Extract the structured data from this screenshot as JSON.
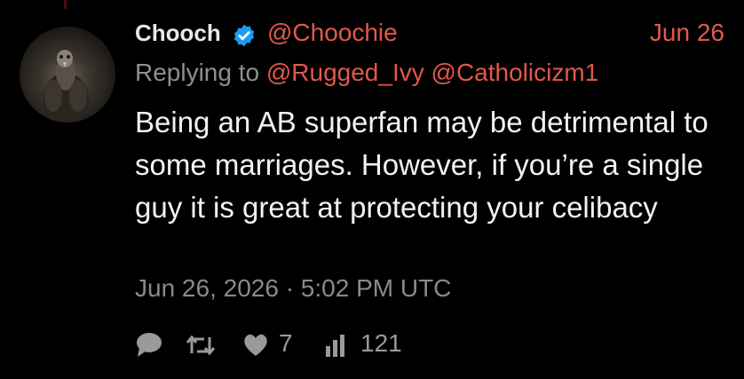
{
  "tweet": {
    "author_name": "Chooch",
    "author_handle": "@Choochie",
    "date_short": "Jun 26",
    "replying_prefix": "Replying to",
    "replying_to": [
      "@Rugged_Ivy",
      "@Catholicizm1"
    ],
    "text": "Being an AB superfan may be detrimental to some marriages. However, if you’re a single guy it is great at protecting your celibacy",
    "timestamp": "Jun 26, 2026 · 5:02 PM UTC",
    "stats": {
      "likes": "7",
      "views": "121"
    }
  },
  "icons": {
    "verified": "verified-badge-icon",
    "reply": "comment-icon",
    "retweet": "retweet-icon",
    "like": "heart-icon",
    "views": "bar-chart-icon"
  },
  "colors": {
    "background": "#000000",
    "accent": "#e2584c",
    "verified": "#1d9bf0",
    "text": "#f2f2f2",
    "muted": "#8a8a8a"
  }
}
